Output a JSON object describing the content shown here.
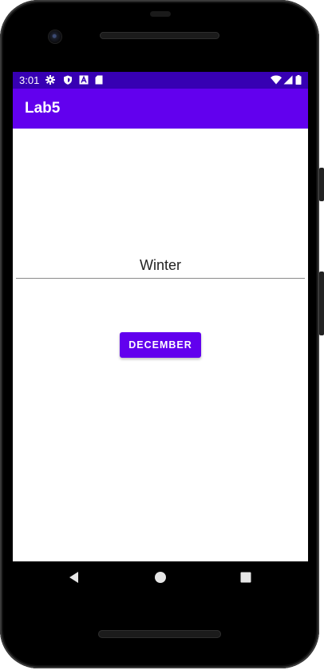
{
  "status_bar": {
    "time": "3:01",
    "left_icons": [
      "settings-icon",
      "shield-icon",
      "a-icon",
      "sd-card-icon"
    ],
    "right_icons": [
      "wifi-icon",
      "signal-icon",
      "battery-icon"
    ]
  },
  "app_bar": {
    "title": "Lab5"
  },
  "main": {
    "season_field": {
      "value": "Winter"
    },
    "month_button": {
      "label": "DECEMBER"
    }
  },
  "nav_bar": {
    "buttons": [
      "back-icon",
      "home-icon",
      "recents-icon"
    ]
  },
  "colors": {
    "status_bar": "#3700b3",
    "primary": "#6200ee",
    "background": "#ffffff"
  }
}
